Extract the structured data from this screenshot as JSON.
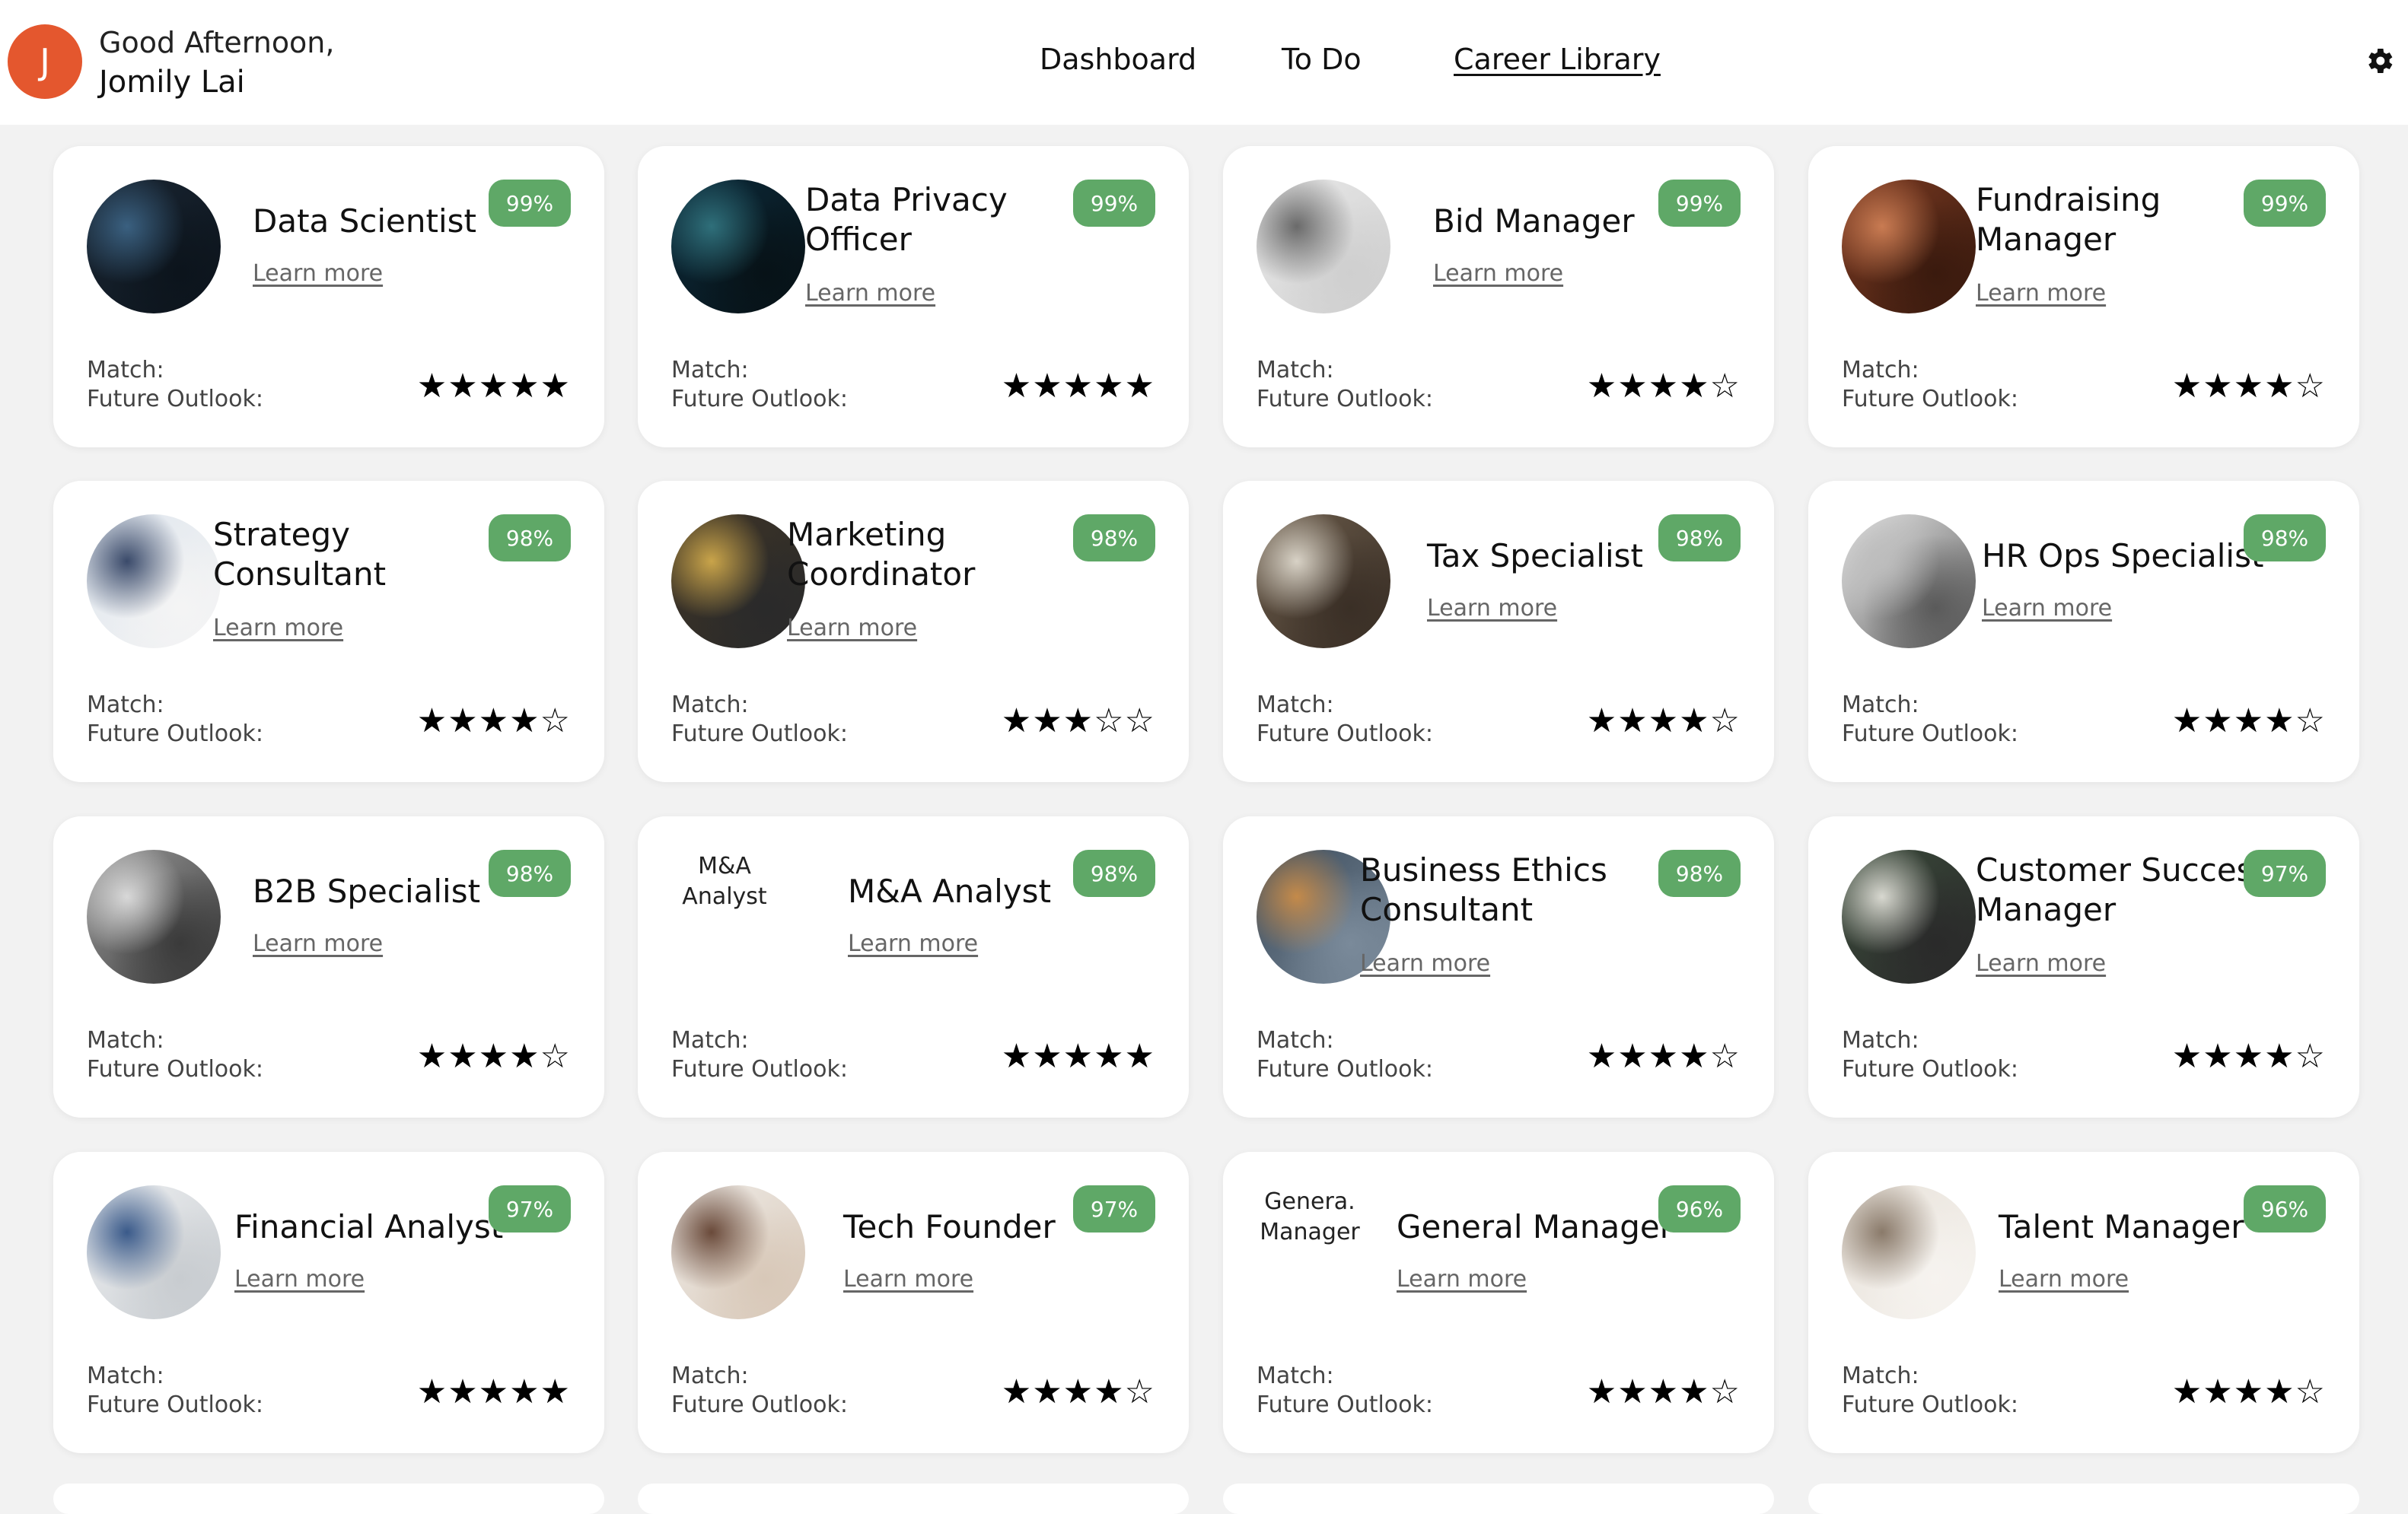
{
  "header": {
    "avatar_initial": "J",
    "greeting": "Good Afternoon,",
    "user_name": "Jomily Lai",
    "nav": [
      "Dashboard",
      "To Do",
      "Career Library"
    ],
    "active_nav": "Career Library"
  },
  "card_labels": {
    "learn_more": "Learn more",
    "match": "Match:",
    "future_outlook": "Future Outlook:"
  },
  "cards": [
    {
      "title": [
        "Data Scientist"
      ],
      "match": "99%",
      "stars": "★★★★★",
      "rating": 5,
      "image": "data-screens"
    },
    {
      "title": [
        "Data Privacy",
        "Officer"
      ],
      "match": "99%",
      "stars": "★★★★★",
      "rating": 5,
      "image": "code-face"
    },
    {
      "title": [
        "Bid Manager"
      ],
      "match": "99%",
      "stars": "★★★★☆",
      "rating": 4,
      "image": "presentation"
    },
    {
      "title": [
        "Fundraising",
        "Manager"
      ],
      "match": "99%",
      "stars": "★★★★☆",
      "rating": 4,
      "image": "hands-wallet"
    },
    {
      "title": [
        "Strategy",
        "Consultant"
      ],
      "match": "98%",
      "stars": "★★★★☆",
      "rating": 4,
      "image": "charts-desk"
    },
    {
      "title": [
        "Marketing",
        "Coordinator"
      ],
      "match": "98%",
      "stars": "★★★☆☆",
      "rating": 3,
      "image": "team-sofa"
    },
    {
      "title": [
        "Tax Specialist"
      ],
      "match": "98%",
      "stars": "★★★★☆",
      "rating": 4,
      "image": "desk-papers"
    },
    {
      "title": [
        "HR Ops Specialist"
      ],
      "match": "98%",
      "stars": "★★★★☆",
      "rating": 4,
      "image": "handshake"
    },
    {
      "title": [
        "B2B Specialist"
      ],
      "match": "98%",
      "stars": "★★★★☆",
      "rating": 4,
      "image": "man-headset"
    },
    {
      "title": [
        "M&A Analyst"
      ],
      "match": "98%",
      "stars": "★★★★★",
      "rating": 5,
      "image_alt": [
        "M&A",
        "Analyst"
      ]
    },
    {
      "title": [
        "Business Ethics",
        "Consultant"
      ],
      "match": "98%",
      "stars": "★★★★☆",
      "rating": 4,
      "image": "gavel"
    },
    {
      "title": [
        "Customer Success",
        "Manager"
      ],
      "match": "97%",
      "stars": "★★★★☆",
      "rating": 4,
      "image": "shop-greeting"
    },
    {
      "title": [
        "Financial Analyst"
      ],
      "match": "97%",
      "stars": "★★★★★",
      "rating": 5,
      "image": "man-laptop"
    },
    {
      "title": [
        "Tech Founder"
      ],
      "match": "97%",
      "stars": "★★★★☆",
      "rating": 4,
      "image": "whiteboard"
    },
    {
      "title": [
        "General Manager"
      ],
      "match": "96%",
      "stars": "★★★★☆",
      "rating": 4,
      "image_alt": [
        "Genera.",
        "Manager"
      ]
    },
    {
      "title": [
        "Talent Manager"
      ],
      "match": "96%",
      "stars": "★★★★☆",
      "rating": 4,
      "image": "clothing-rack"
    }
  ],
  "colors": {
    "avatar": "#e4572e",
    "badge": "#5fa867",
    "background": "#f2f2f2",
    "card": "#ffffff"
  }
}
